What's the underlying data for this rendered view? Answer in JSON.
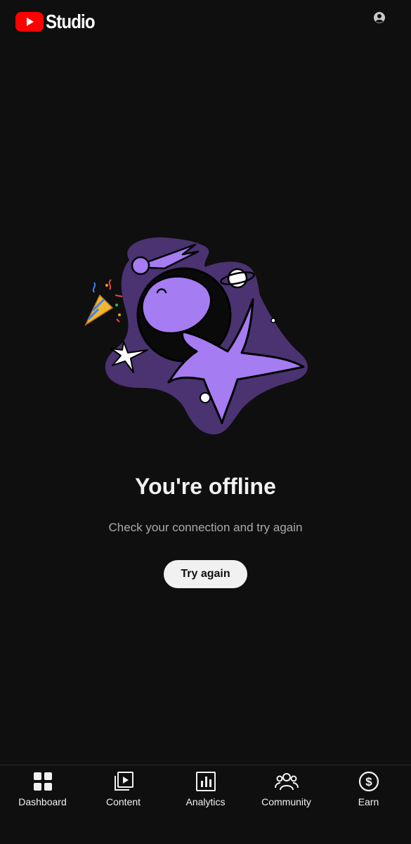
{
  "app": {
    "logo_text": "Studio",
    "brand_color": "#ff0000"
  },
  "header": {
    "account_icon": "account-circle-icon"
  },
  "offline": {
    "title": "You're offline",
    "message": "Check your connection and try again",
    "retry_label": "Try again",
    "illustration_colors": {
      "purple": "#a57cf2",
      "dark_purple": "#4a3370",
      "background": "#0f0f0f"
    }
  },
  "bottom_nav": {
    "items": [
      {
        "label": "Dashboard",
        "icon": "dashboard-icon"
      },
      {
        "label": "Content",
        "icon": "content-icon"
      },
      {
        "label": "Analytics",
        "icon": "analytics-icon"
      },
      {
        "label": "Community",
        "icon": "community-icon"
      },
      {
        "label": "Earn",
        "icon": "earn-icon"
      }
    ]
  }
}
